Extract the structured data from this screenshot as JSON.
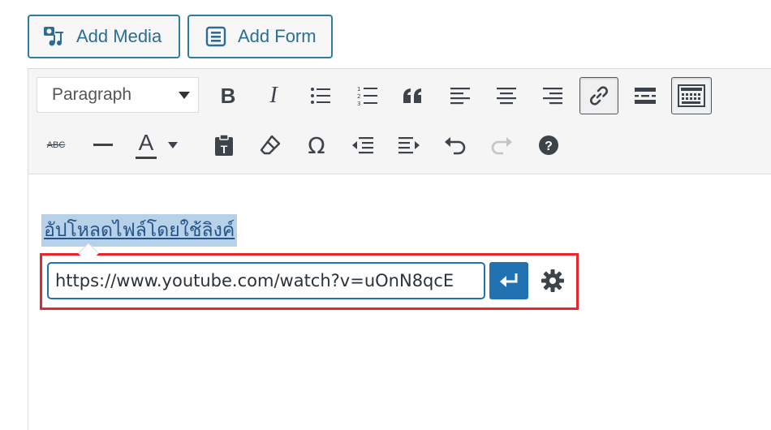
{
  "media_buttons": {
    "add_media": "Add Media",
    "add_form": "Add Form"
  },
  "toolbar": {
    "format_select": "Paragraph",
    "row1_icons": [
      "bold-icon",
      "italic-icon",
      "bullet-list-icon",
      "numbered-list-icon",
      "blockquote-icon",
      "align-left-icon",
      "align-center-icon",
      "align-right-icon",
      "link-icon",
      "read-more-icon",
      "toolbar-toggle-icon"
    ],
    "row2_icons": [
      "strikethrough-icon",
      "horizontal-line-icon",
      "text-color-icon",
      "paste-text-icon",
      "clear-formatting-icon",
      "special-character-icon",
      "outdent-icon",
      "indent-icon",
      "undo-icon",
      "redo-icon",
      "help-icon"
    ],
    "bold_label": "B",
    "italic_label": "I",
    "strike_label": "ABC",
    "text_color_label": "A",
    "omega_label": "Ω",
    "link_active": true
  },
  "content": {
    "selected_text": "อัปโหลดไฟล์โดยใช้ลิงค์"
  },
  "link_popup": {
    "url_value": "https://www.youtube.com/watch?v=uOnN8qcE"
  },
  "colors": {
    "accent": "#2271b1",
    "highlight_border": "#e8262b",
    "selection": "#b6d1e8"
  }
}
